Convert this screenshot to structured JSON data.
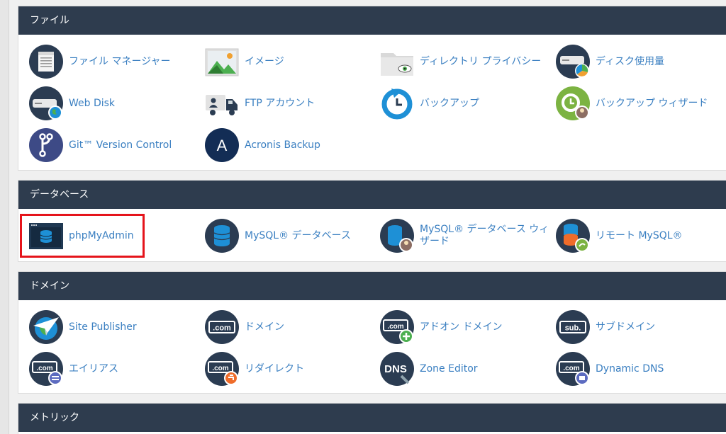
{
  "sections": {
    "files": {
      "title": "ファイル",
      "items": [
        {
          "label": "ファイル マネージャー",
          "icon": "file-manager-icon"
        },
        {
          "label": "イメージ",
          "icon": "images-icon"
        },
        {
          "label": "ディレクトリ プライバシー",
          "icon": "directory-privacy-icon"
        },
        {
          "label": "ディスク使用量",
          "icon": "disk-usage-icon"
        },
        {
          "label": "Web Disk",
          "icon": "web-disk-icon"
        },
        {
          "label": "FTP アカウント",
          "icon": "ftp-accounts-icon"
        },
        {
          "label": "バックアップ",
          "icon": "backup-icon"
        },
        {
          "label": "バックアップ ウィザード",
          "icon": "backup-wizard-icon"
        },
        {
          "label": "Git™ Version Control",
          "icon": "git-icon"
        },
        {
          "label": "Acronis Backup",
          "icon": "acronis-icon"
        }
      ]
    },
    "databases": {
      "title": "データベース",
      "items": [
        {
          "label": "phpMyAdmin",
          "icon": "phpmyadmin-icon"
        },
        {
          "label": "MySQL® データベース",
          "icon": "mysql-databases-icon"
        },
        {
          "label": "MySQL® データベース ウィザード",
          "icon": "mysql-wizard-icon"
        },
        {
          "label": "リモート MySQL®",
          "icon": "remote-mysql-icon"
        }
      ]
    },
    "domains": {
      "title": "ドメイン",
      "items": [
        {
          "label": "Site Publisher",
          "icon": "site-publisher-icon"
        },
        {
          "label": "ドメイン",
          "icon": "domains-icon"
        },
        {
          "label": "アドオン ドメイン",
          "icon": "addon-domains-icon"
        },
        {
          "label": "サブドメイン",
          "icon": "subdomains-icon"
        },
        {
          "label": "エイリアス",
          "icon": "aliases-icon"
        },
        {
          "label": "リダイレクト",
          "icon": "redirects-icon"
        },
        {
          "label": "Zone Editor",
          "icon": "zone-editor-icon"
        },
        {
          "label": "Dynamic DNS",
          "icon": "dynamic-dns-icon"
        }
      ]
    },
    "metrics": {
      "title": "メトリック"
    }
  },
  "icon_text": {
    "com": ".com",
    "sub": "sub.",
    "dns": "DNS",
    "acronis": "A"
  },
  "colors": {
    "header_bg": "#2e3c4e",
    "link": "#3a7fc1",
    "highlight": "#e5141b",
    "icon_navy": "#2b3c52",
    "icon_blue": "#1e90d6",
    "icon_green": "#4caf50",
    "icon_orange": "#ef6c2a"
  }
}
